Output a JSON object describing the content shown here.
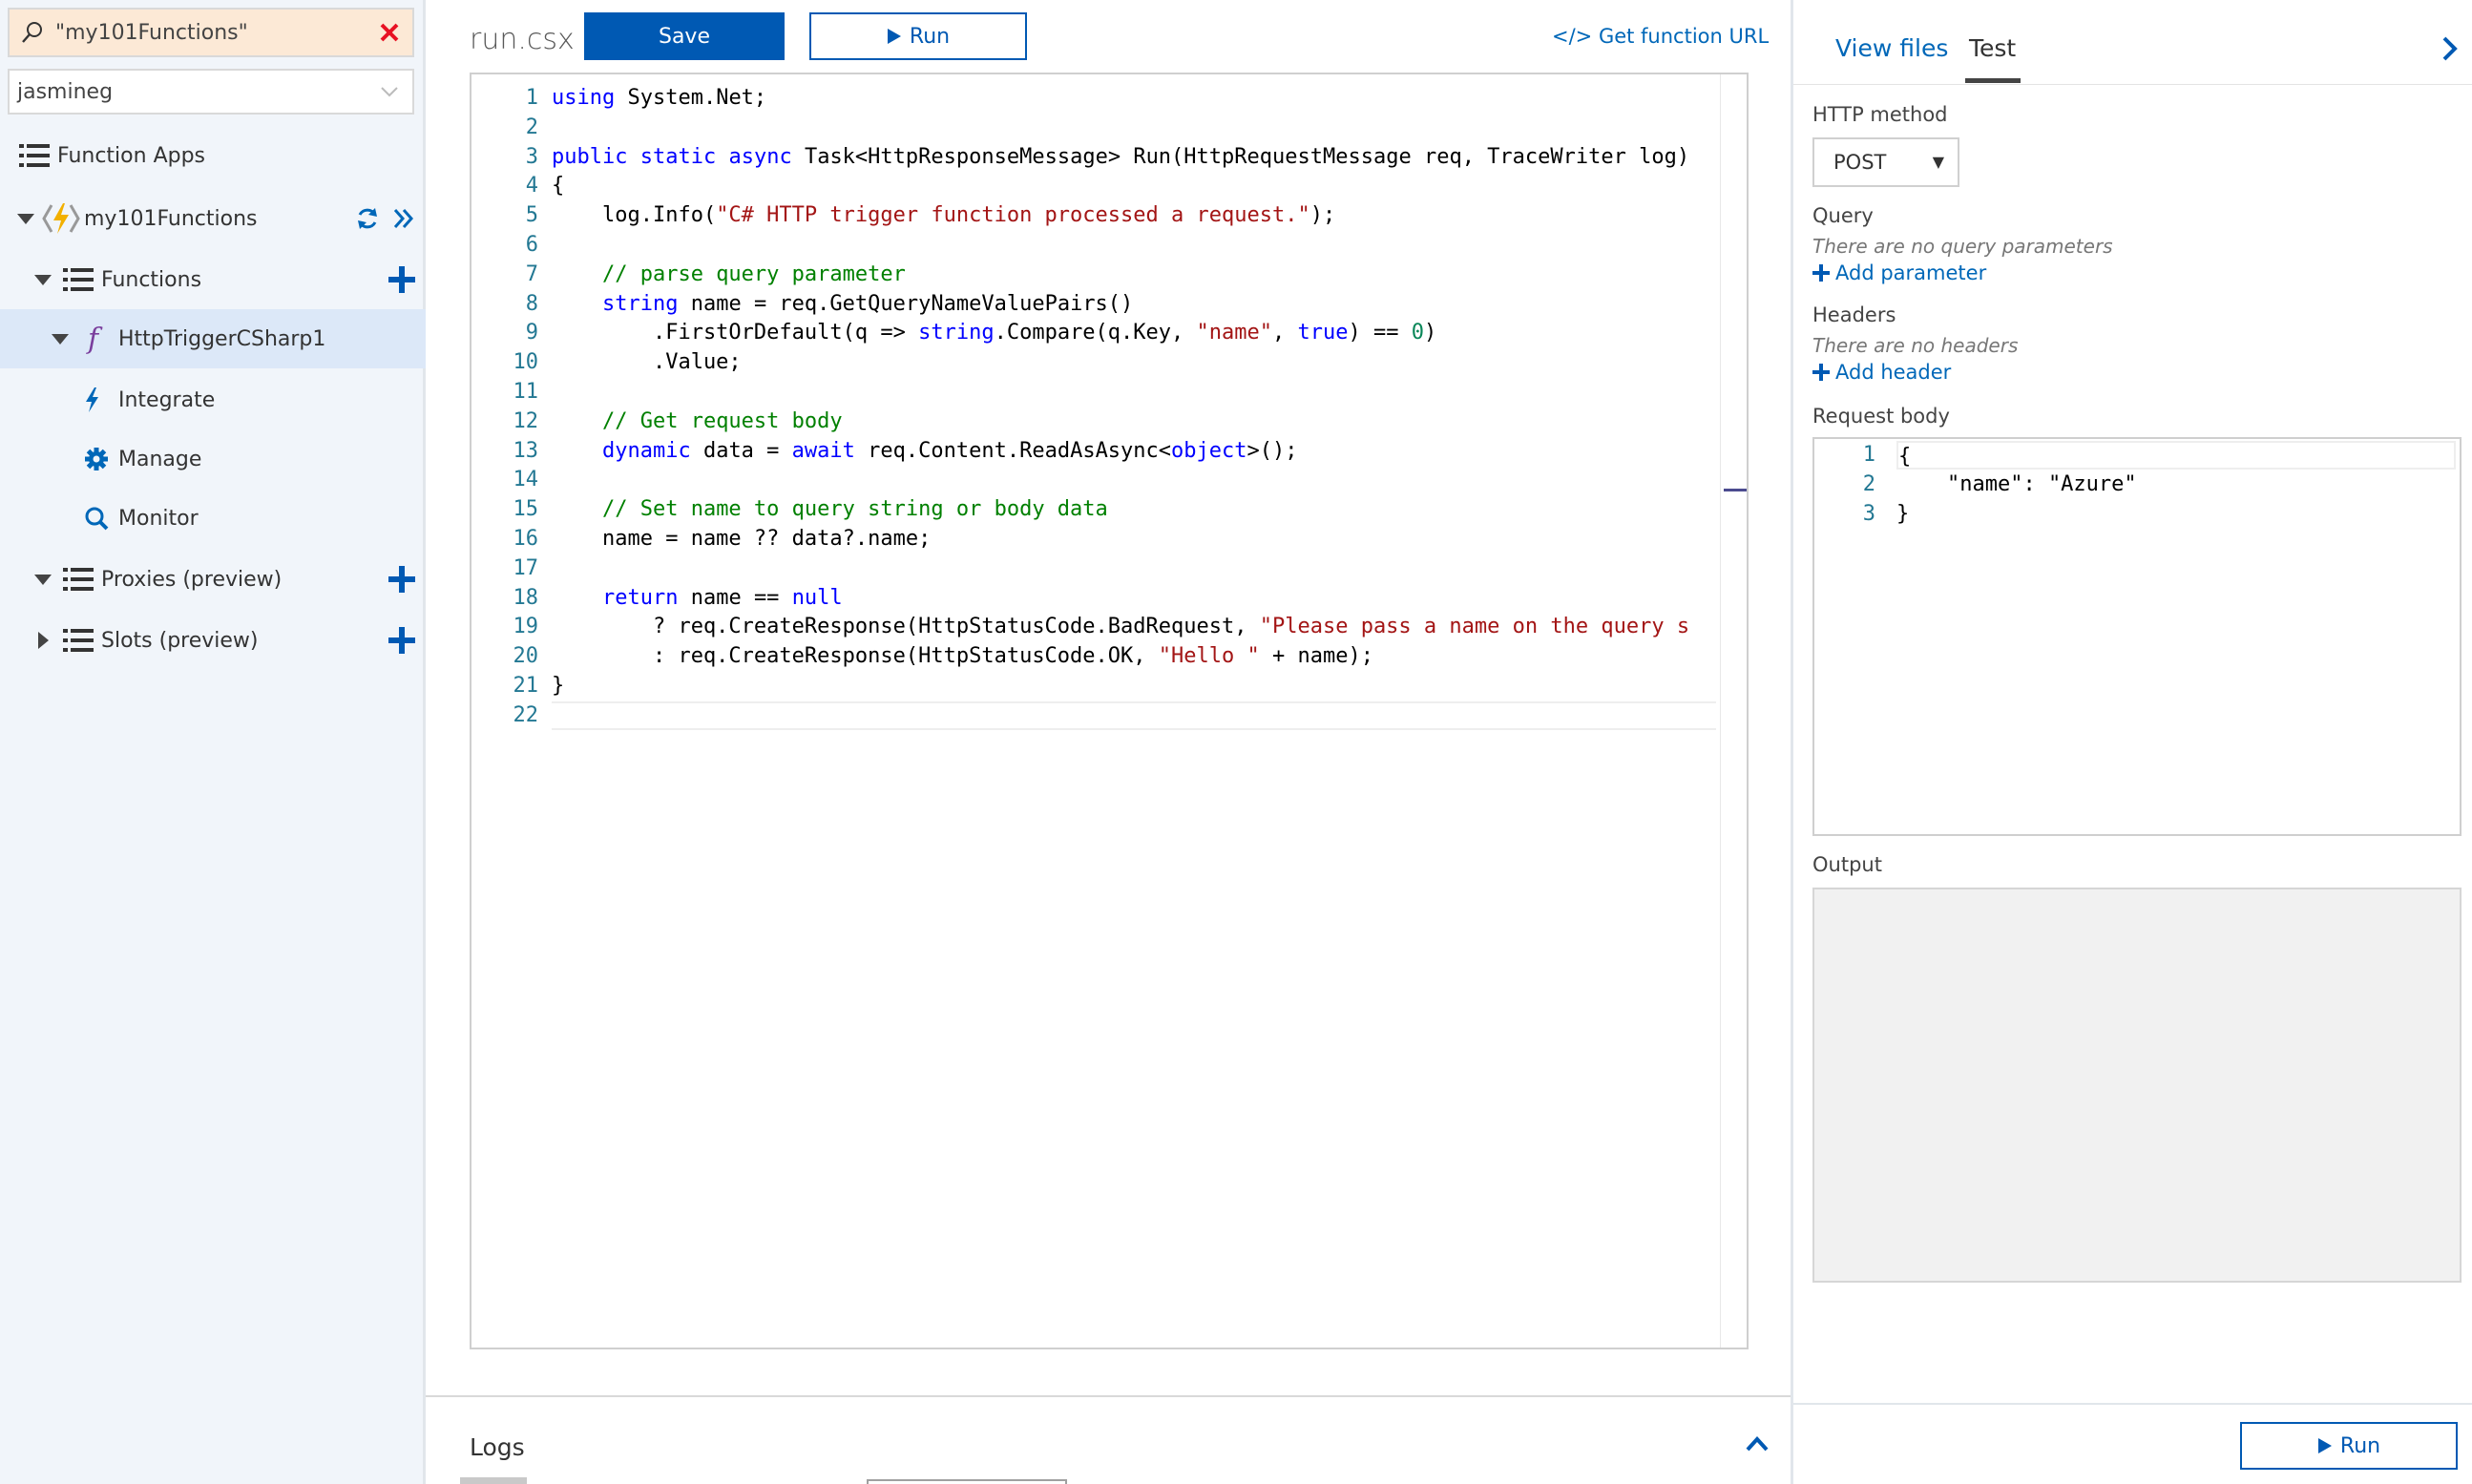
{
  "colors": {
    "accent": "#0059b3",
    "link": "#0067b8",
    "search_bg": "#fce9d6",
    "selected_row": "#dce8f8",
    "sidebar_bg": "#f1f5fa",
    "clear_red": "#e81123"
  },
  "sidebar": {
    "search": {
      "value": "\"my101Functions\"",
      "icon": "search-icon",
      "clear_icon": "close-icon"
    },
    "subscription": {
      "value": "jasmineg",
      "icon": "chevron-down-icon"
    },
    "items": [
      {
        "label": "Function Apps",
        "icon": "list-icon"
      },
      {
        "label": "my101Functions",
        "icon": "function-app-icon"
      },
      {
        "label": "Functions",
        "icon": "list-icon"
      },
      {
        "label": "HttpTriggerCSharp1",
        "icon": "function-icon",
        "glyph": "f"
      },
      {
        "label": "Integrate",
        "icon": "lightning-icon"
      },
      {
        "label": "Manage",
        "icon": "gear-icon"
      },
      {
        "label": "Monitor",
        "icon": "search-icon"
      },
      {
        "label": "Proxies (preview)",
        "icon": "list-icon"
      },
      {
        "label": "Slots (preview)",
        "icon": "list-icon"
      }
    ]
  },
  "editor": {
    "file_name": "run.csx",
    "save_label": "Save",
    "run_label": "Run",
    "get_url_label": "</> Get function URL",
    "line_numbers": [
      "1",
      "2",
      "3",
      "4",
      "5",
      "6",
      "7",
      "8",
      "9",
      "10",
      "11",
      "12",
      "13",
      "14",
      "15",
      "16",
      "17",
      "18",
      "19",
      "20",
      "21",
      "22"
    ],
    "lines": [
      "using System.Net;",
      "",
      "public static async Task<HttpResponseMessage> Run(HttpRequestMessage req, TraceWriter log)",
      "{",
      "    log.Info(\"C# HTTP trigger function processed a request.\");",
      "",
      "    // parse query parameter",
      "    string name = req.GetQueryNameValuePairs()",
      "        .FirstOrDefault(q => string.Compare(q.Key, \"name\", true) == 0)",
      "        .Value;",
      "",
      "    // Get request body",
      "    dynamic data = await req.Content.ReadAsAsync<object>();",
      "",
      "    // Set name to query string or body data",
      "    name = name ?? data?.name;",
      "",
      "    return name == null",
      "        ? req.CreateResponse(HttpStatusCode.BadRequest, \"Please pass a name on the query s",
      "        : req.CreateResponse(HttpStatusCode.OK, \"Hello \" + name);",
      "}",
      ""
    ]
  },
  "logs": {
    "title": "Logs",
    "icon": "chevron-up-icon"
  },
  "test_panel": {
    "tabs": [
      "View files",
      "Test"
    ],
    "active_tab": "Test",
    "collapse_icon": "chevron-right-icon",
    "http_method_label": "HTTP method",
    "http_method_value": "POST",
    "query_label": "Query",
    "query_empty": "There are no query parameters",
    "add_parameter": "Add parameter",
    "headers_label": "Headers",
    "headers_empty": "There are no headers",
    "add_header": "Add header",
    "request_body_label": "Request body",
    "request_body_line_numbers": [
      "1",
      "2",
      "3"
    ],
    "request_body_lines": [
      "{",
      "    \"name\": \"Azure\"",
      "}"
    ],
    "output_label": "Output",
    "run_label": "Run"
  }
}
